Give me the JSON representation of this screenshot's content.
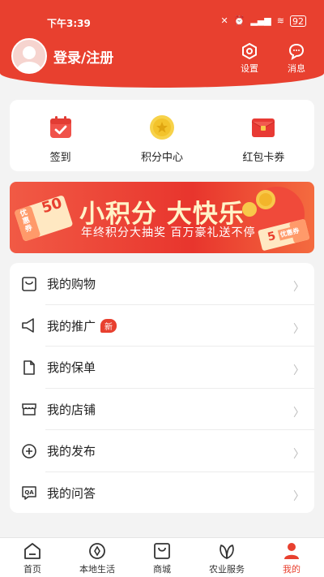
{
  "status_bar": {
    "time": "下午3:39",
    "battery": "92"
  },
  "header": {
    "login_label": "登录/注册",
    "settings_label": "设置",
    "messages_label": "消息"
  },
  "quick_actions": [
    {
      "label": "签到",
      "icon": "calendar-check-icon"
    },
    {
      "label": "积分中心",
      "icon": "coin-star-icon"
    },
    {
      "label": "红包卡券",
      "icon": "red-envelope-icon"
    }
  ],
  "banner": {
    "title": "小积分 大快乐",
    "subtitle": "年终积分大抽奖  百万豪礼送不停",
    "coupon_left_text": "优惠券",
    "coupon_left_value": "50",
    "coupon_right_value": "5",
    "coupon_right_text": "优惠券"
  },
  "menu": [
    {
      "label": "我的购物",
      "icon": "shopping-bag-icon"
    },
    {
      "label": "我的推广",
      "icon": "megaphone-icon",
      "badge": "新"
    },
    {
      "label": "我的保单",
      "icon": "document-icon"
    },
    {
      "label": "我的店铺",
      "icon": "store-icon"
    },
    {
      "label": "我的发布",
      "icon": "plus-circle-icon"
    },
    {
      "label": "我的问答",
      "icon": "qa-icon"
    }
  ],
  "tabs": [
    {
      "label": "首页",
      "icon": "home-icon"
    },
    {
      "label": "本地生活",
      "icon": "compass-icon"
    },
    {
      "label": "商城",
      "icon": "bag-icon"
    },
    {
      "label": "农业服务",
      "icon": "leaf-icon"
    },
    {
      "label": "我的",
      "icon": "person-icon",
      "active": true
    }
  ],
  "colors": {
    "accent": "#e8402f",
    "background": "#f3f3f3"
  }
}
